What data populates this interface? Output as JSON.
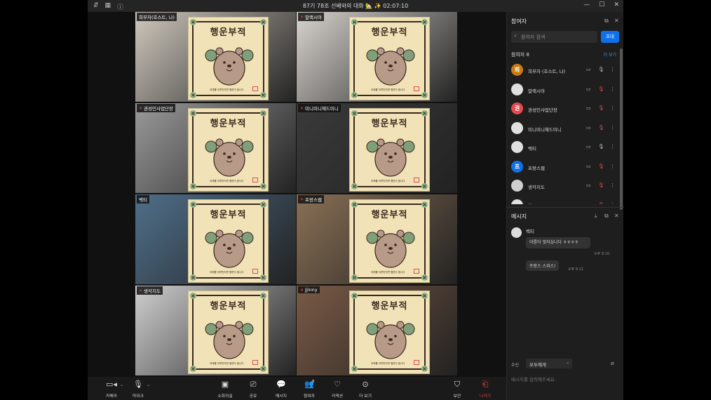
{
  "window": {
    "title": "87기 78조 선배와의 대화 🏡 ✨ 02:07:10",
    "controls": [
      "minimize-icon",
      "maximize-icon",
      "close-icon"
    ]
  },
  "gallery": {
    "tiles": [
      {
        "name": "희부자(호스트, 나)",
        "mic_muted": false,
        "active": true,
        "bg": "#cfc8bd"
      },
      {
        "name": "말랙시아",
        "mic_muted": true,
        "active": false,
        "bg": "#d8d4cf"
      },
      {
        "name": "권성민사업단장",
        "mic_muted": true,
        "active": false,
        "bg": "#9a9a9a"
      },
      {
        "name": "미니미니헤드미니",
        "mic_muted": true,
        "active": false,
        "bg": "#3a3a3a"
      },
      {
        "name": "벡티",
        "mic_muted": false,
        "active": true,
        "bg": "#4f6f8a"
      },
      {
        "name": "프랑스웹",
        "mic_muted": true,
        "active": false,
        "bg": "#8a7055"
      },
      {
        "name": "생각지도",
        "mic_muted": true,
        "active": false,
        "bg": "#cfcfcf"
      },
      {
        "name": "Jjinny",
        "mic_muted": true,
        "active": false,
        "bg": "#7a5a45"
      }
    ],
    "card_title": "행운부적",
    "card_footer": "아래를 어루만지면 행운이 옵니다"
  },
  "participants_panel": {
    "title": "참여자",
    "search_placeholder": "참여자 검색",
    "invite_label": "초대",
    "count_label": "참여자 8",
    "more_label": "더 보기",
    "people": [
      {
        "name": "희부자 (호스트, 나)",
        "initial": "희",
        "color": "#c97b14",
        "mic_muted": false
      },
      {
        "name": "말랙시아",
        "initial": "",
        "color": "#e0e0e0",
        "mic_muted": true
      },
      {
        "name": "권성민사업단장",
        "initial": "권",
        "color": "#e5484d",
        "mic_muted": true
      },
      {
        "name": "미니미니헤드미니",
        "initial": "",
        "color": "#e0e0e0",
        "mic_muted": true
      },
      {
        "name": "벡티",
        "initial": "",
        "color": "#e0e0e0",
        "mic_muted": false
      },
      {
        "name": "프랑스웹",
        "initial": "프",
        "color": "#0e71eb",
        "mic_muted": true
      },
      {
        "name": "생각지도",
        "initial": "",
        "color": "#cfcfcf",
        "mic_muted": true
      },
      {
        "name": "Jjinny",
        "initial": "",
        "color": "#e0e0e0",
        "mic_muted": true
      }
    ]
  },
  "chat_panel": {
    "title": "메시지",
    "sender": "벡티",
    "messages": [
      {
        "text": "이름이 멋지십니다 ㅎㅎㅎㅎ",
        "time": "오후 9:10"
      },
      {
        "text": "프랑스 스위스!",
        "time": "오후 9:11"
      }
    ],
    "to_label": "수신",
    "to_value": "모두에게",
    "input_placeholder": "메시지를 입력해주세요."
  },
  "toolbar": {
    "camera": "카메라",
    "mic": "마이크",
    "breakout": "소회의실",
    "share": "공유",
    "chat": "메시지",
    "participants": "참여자",
    "participants_count": "8",
    "reactions": "리액션",
    "more": "더 보기",
    "security": "보안",
    "leave": "나가기",
    "leave_color": "#e5484d"
  }
}
